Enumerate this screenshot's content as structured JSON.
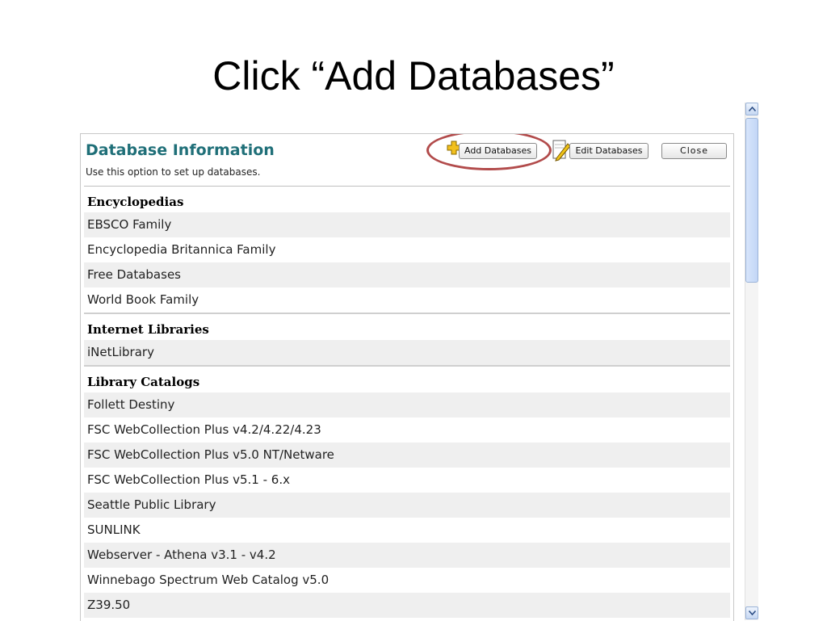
{
  "slide": {
    "title": "Click “Add Databases”"
  },
  "panel": {
    "title": "Database Information",
    "subtitle": "Use this option to set up databases.",
    "buttons": {
      "add": "Add Databases",
      "edit": "Edit Databases",
      "close": "Close"
    },
    "sections": [
      {
        "heading": "Encyclopedias",
        "items": [
          "EBSCO Family",
          "Encyclopedia Britannica Family",
          "Free Databases",
          "World Book Family"
        ]
      },
      {
        "heading": "Internet Libraries",
        "items": [
          "iNetLibrary"
        ]
      },
      {
        "heading": "Library Catalogs",
        "items": [
          "Follett Destiny",
          "FSC WebCollection Plus v4.2/4.22/4.23",
          "FSC WebCollection Plus v5.0 NT/Netware",
          "FSC WebCollection Plus v5.1 - 6.x",
          "Seattle Public Library",
          "SUNLINK",
          "Webserver - Athena v3.1 - v4.2",
          "Winnebago Spectrum Web Catalog v5.0",
          "Z39.50"
        ]
      }
    ]
  },
  "icons": {
    "add": "plus-icon",
    "edit": "pencil-icon",
    "scroll_up": "chevron-up-icon",
    "scroll_down": "chevron-down-icon"
  },
  "colors": {
    "title_accent": "#1f6f78",
    "highlight": "#b24b4b",
    "plus_icon": "#f2c01e"
  }
}
